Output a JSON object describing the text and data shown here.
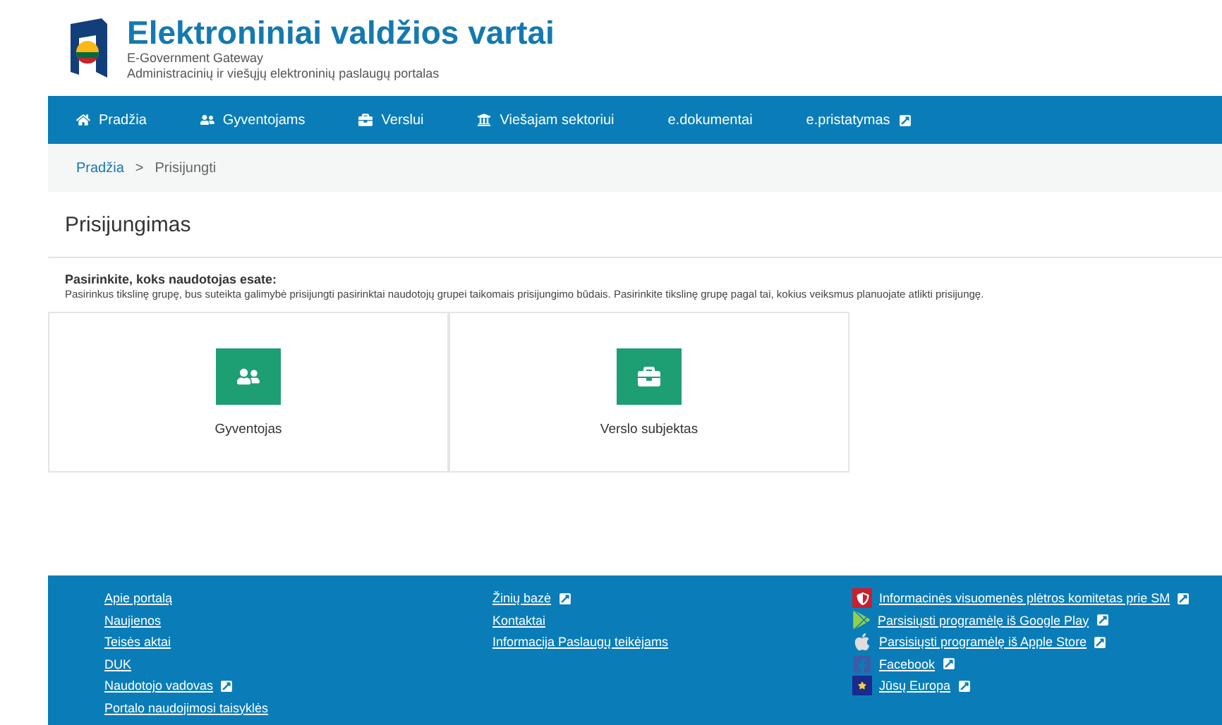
{
  "header": {
    "title": "Elektroniniai valdžios vartai",
    "subtitle": "E-Government Gateway",
    "tagline": "Administracinių ir viešųjų elektroninių paslaugų portalas"
  },
  "nav": [
    {
      "label": "Pradžia",
      "kind": "home",
      "external": false
    },
    {
      "label": "Gyventojams",
      "kind": "people",
      "external": false
    },
    {
      "label": "Verslui",
      "kind": "briefcase",
      "external": false
    },
    {
      "label": "Viešajam sektoriui",
      "kind": "bank",
      "external": false
    },
    {
      "label": "e.dokumentai",
      "kind": "none",
      "external": false
    },
    {
      "label": "e.pristatymas",
      "kind": "none",
      "external": true
    }
  ],
  "breadcrumb": [
    "Pradžia",
    "Prisijungti"
  ],
  "breadcrumb_separator": ">",
  "page_title": "Prisijungimas",
  "intro": {
    "heading": "Pasirinkite, koks naudotojas esate:",
    "text": "Pasirinkus tikslinę grupę, bus suteikta galimybė prisijungti pasirinktai naudotojų grupei taikomais prisijungimo būdais. Pasirinkite tikslinę grupę pagal tai, kokius veiksmus planuojate atlikti prisijungę."
  },
  "options": [
    {
      "label": "Gyventojas",
      "kind": "people"
    },
    {
      "label": "Verslo subjektas",
      "kind": "briefcase"
    }
  ],
  "footer": {
    "columns": [
      [
        {
          "label": "Apie portalą",
          "external": false
        },
        {
          "label": "Naujienos",
          "external": false
        },
        {
          "label": "Teisės aktai",
          "external": false
        },
        {
          "label": "DUK",
          "external": false
        },
        {
          "label": "Naudotojo vadovas",
          "external": true
        },
        {
          "label": "Portalo naudojimosi taisyklės",
          "external": false
        }
      ],
      [
        {
          "label": "Žinių bazė",
          "external": true
        },
        {
          "label": "Kontaktai",
          "external": false
        },
        {
          "label": "Informacija Paslaugų teikėjams",
          "external": false
        }
      ],
      [
        {
          "label": "Informacinės visuomenės plėtros komitetas prie SM",
          "external": true,
          "kind": "crest"
        },
        {
          "label": "Parsisiųsti programėlę iš Google Play",
          "external": true,
          "kind": "play"
        },
        {
          "label": "Parsisiųsti programėlę iš Apple Store",
          "external": true,
          "kind": "apple"
        },
        {
          "label": "Facebook",
          "external": true,
          "kind": "facebook"
        },
        {
          "label": "Jūsų Europa",
          "external": true,
          "kind": "eu"
        }
      ]
    ]
  }
}
